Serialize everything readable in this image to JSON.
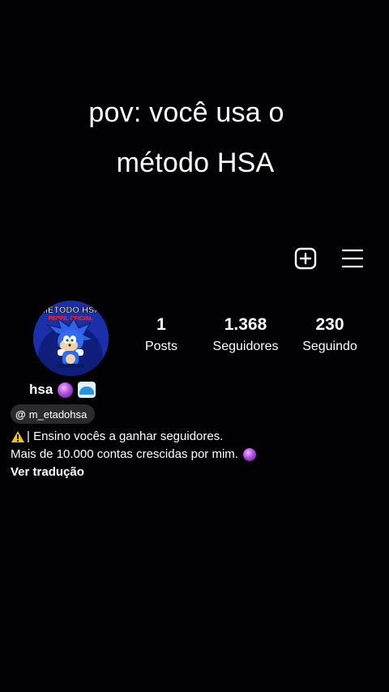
{
  "overlay": {
    "caption_line1": "pov: você usa o",
    "caption_line2": "método HSA"
  },
  "header": {
    "icons": [
      "add-square-icon",
      "hamburger-menu-icon"
    ]
  },
  "profile": {
    "avatar_text_top": "MÉTODO HSA",
    "avatar_text_sub": "PERFIL OFICIAL",
    "username": "hsa",
    "username_emojis": [
      "crystal-ball-emoji",
      "wave-emoji"
    ],
    "threads_handle": "m_etadohsa"
  },
  "stats": {
    "posts_value": "1",
    "posts_label": "Posts",
    "followers_value": "1.368",
    "followers_label": "Seguidores",
    "following_value": "230",
    "following_label": "Seguindo"
  },
  "bio": {
    "line1": "| Ensino vocês a ganhar seguidores.",
    "line2": "Mais de 10.000 contas crescidas por mim.",
    "translate_link": "Ver tradução"
  },
  "colors": {
    "background": "#020204",
    "text": "#ffffff",
    "chip": "#2a2a2c",
    "avatar_blue": "#1b2fa8"
  }
}
